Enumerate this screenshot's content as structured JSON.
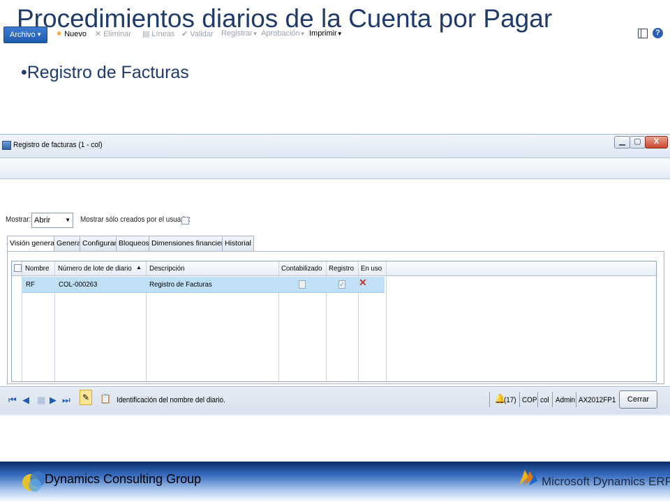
{
  "slide": {
    "title": "Procedimientos diarios de la Cuenta por Pagar",
    "bullet": "•Registro de Facturas"
  },
  "window": {
    "title": "Registro de facturas (1 - col)",
    "controls": {
      "minimize": "▁",
      "maximize": "▢",
      "close": "X"
    }
  },
  "actionpane": {
    "archivo": "Archivo",
    "items": {
      "nuevo": "Nuevo",
      "eliminar": "Eliminar",
      "lineas": "Líneas",
      "validar": "Validar",
      "registrar": "Registrar",
      "aprobacion": "Aprobación",
      "imprimir": "Imprimir"
    },
    "help": "?"
  },
  "filter": {
    "mostrar_label": "Mostrar:",
    "mostrar_value": "Abrir",
    "owner_label": "Mostrar sólo creados por el usuario:"
  },
  "tabs": [
    "Visión general",
    "General",
    "Configurar",
    "Bloqueos",
    "Dimensiones financieras",
    "Historial"
  ],
  "grid": {
    "columns": [
      "Nombre",
      "Número de lote de diario",
      "Descripción",
      "Contabilizado",
      "Registro",
      "En uso"
    ],
    "rows": [
      {
        "nombre": "RF",
        "lote": "COL-000263",
        "descripcion": "Registro de Facturas",
        "contabilizado": false,
        "registro": true,
        "en_uso": "✕"
      }
    ]
  },
  "statusbar": {
    "message": "Identificación del nombre del diario.",
    "alerts": "(17)",
    "currency": "COP",
    "company": "col",
    "user": "Admin",
    "server": "AX2012FP1",
    "cerrar": "Cerrar"
  },
  "footer": {
    "company": "Dynamics Consulting Group",
    "product": "Microsoft Dynamics ERP"
  },
  "colors": {
    "title": "#1f3a6b",
    "selected_row": "#bfe0f7",
    "archivo_button": "#2a64b8"
  }
}
